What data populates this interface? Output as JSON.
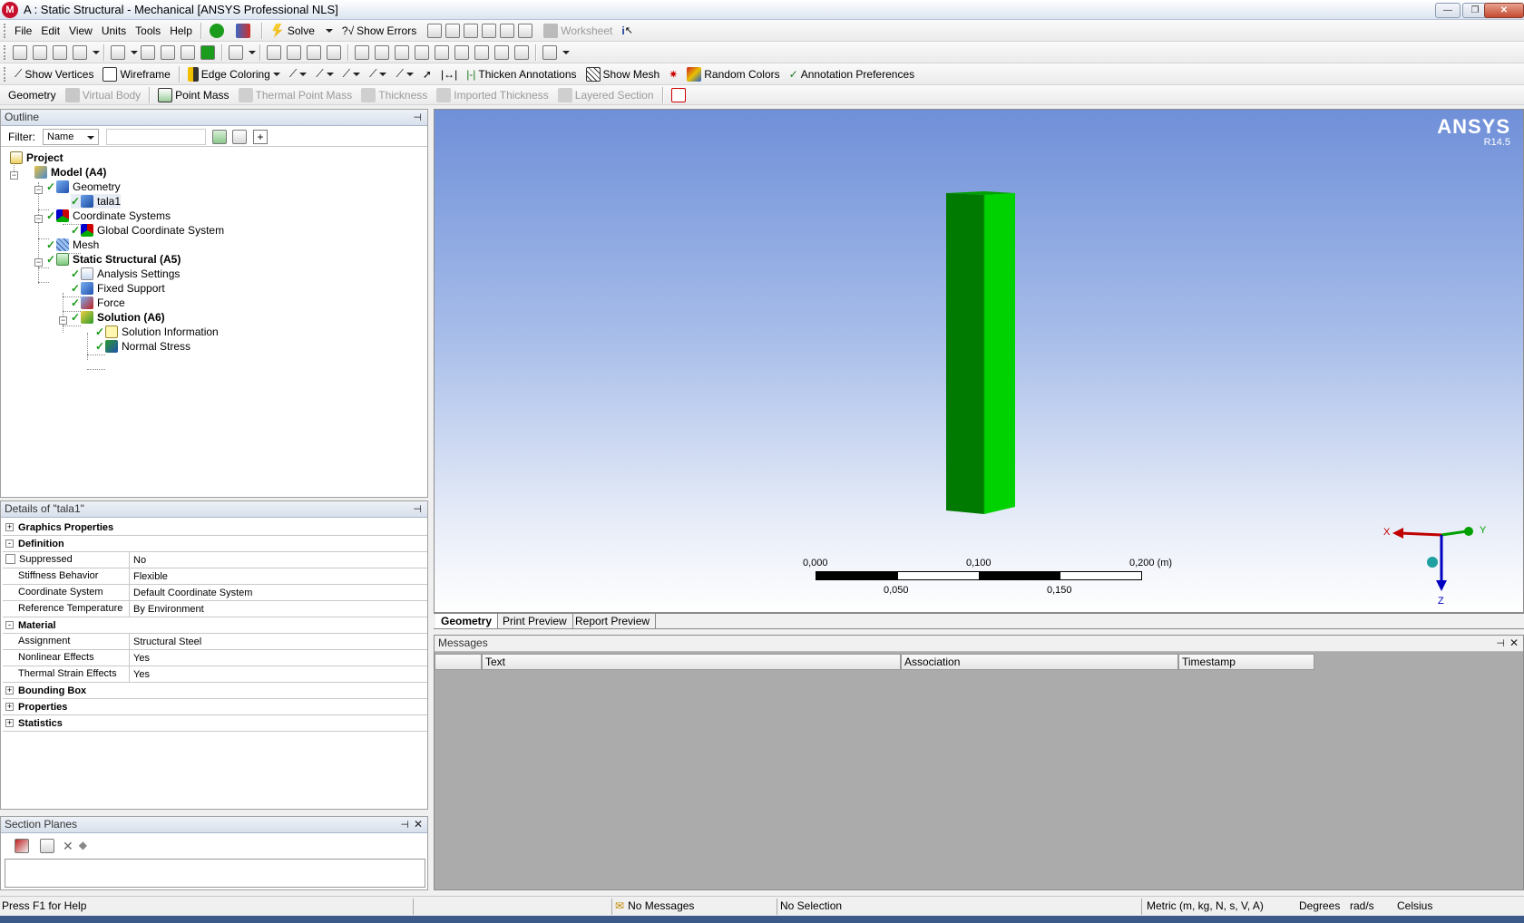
{
  "window": {
    "title": "A : Static Structural - Mechanical [ANSYS Professional NLS]",
    "app_icon": "M"
  },
  "menu": [
    "File",
    "Edit",
    "View",
    "Units",
    "Tools",
    "Help"
  ],
  "main_toolbar": {
    "solve": "Solve",
    "show_errors": "Show Errors",
    "worksheet": "Worksheet"
  },
  "graphics_toolbar": {
    "show_vertices": "Show Vertices",
    "wireframe": "Wireframe",
    "edge_coloring": "Edge Coloring",
    "thicken_annotations": "Thicken Annotations",
    "show_mesh": "Show Mesh",
    "random_colors": "Random Colors",
    "annotation_preferences": "Annotation Preferences"
  },
  "context_toolbar": {
    "geometry": "Geometry",
    "virtual_body": "Virtual Body",
    "point_mass": "Point Mass",
    "thermal_point_mass": "Thermal Point Mass",
    "thickness": "Thickness",
    "imported_thickness": "Imported Thickness",
    "layered_section": "Layered Section"
  },
  "outline": {
    "header": "Outline",
    "filter_label": "Filter:",
    "filter_value": "Name",
    "tree": [
      {
        "label": "Project",
        "bold": true
      },
      {
        "label": "Model (A4)",
        "bold": true
      },
      {
        "label": "Geometry",
        "bold": false
      },
      {
        "label": "tala1",
        "bold": false
      },
      {
        "label": "Coordinate Systems",
        "bold": false
      },
      {
        "label": "Global Coordinate System",
        "bold": false
      },
      {
        "label": "Mesh",
        "bold": false
      },
      {
        "label": "Static Structural (A5)",
        "bold": true
      },
      {
        "label": "Analysis Settings",
        "bold": false
      },
      {
        "label": "Fixed Support",
        "bold": false
      },
      {
        "label": "Force",
        "bold": false
      },
      {
        "label": "Solution (A6)",
        "bold": true
      },
      {
        "label": "Solution Information",
        "bold": false
      },
      {
        "label": "Normal Stress",
        "bold": false
      }
    ]
  },
  "details": {
    "header": "Details of \"tala1\"",
    "rows": [
      {
        "category": "Graphics Properties",
        "expander": "+"
      },
      {
        "category": "Definition",
        "expander": "-"
      },
      {
        "key": "Suppressed",
        "value": "No"
      },
      {
        "key": "Stiffness Behavior",
        "value": "Flexible"
      },
      {
        "key": "Coordinate System",
        "value": "Default Coordinate System"
      },
      {
        "key": "Reference Temperature",
        "value": "By Environment"
      },
      {
        "category": "Material",
        "expander": "-"
      },
      {
        "key": "Assignment",
        "value": "Structural Steel"
      },
      {
        "key": "Nonlinear Effects",
        "value": "Yes"
      },
      {
        "key": "Thermal Strain Effects",
        "value": "Yes"
      },
      {
        "category": "Bounding Box",
        "expander": "+"
      },
      {
        "category": "Properties",
        "expander": "+"
      },
      {
        "category": "Statistics",
        "expander": "+"
      }
    ]
  },
  "section_planes": {
    "header": "Section Planes"
  },
  "viewport": {
    "brand": "ANSYS",
    "version": "R14.5",
    "scale": {
      "top_labels": [
        "0,000",
        "0,100",
        "0,200 (m)"
      ],
      "bottom_labels": [
        "0,050",
        "0,150"
      ]
    },
    "triad": {
      "x": "X",
      "y": "Y",
      "z": "Z"
    },
    "colors": {
      "body_front": "#007a00",
      "body_side": "#00d100",
      "x_axis": "#c00000",
      "y_axis": "#00a000",
      "z_axis": "#0000c0"
    }
  },
  "view_tabs": [
    "Geometry",
    "Print Preview",
    "Report Preview"
  ],
  "messages": {
    "header": "Messages",
    "columns": [
      "Text",
      "Association",
      "Timestamp"
    ]
  },
  "status": {
    "help": "Press F1 for Help",
    "messages": "No Messages",
    "selection": "No Selection",
    "units": "Metric (m, kg, N, s, V, A)",
    "angle": "Degrees",
    "rate": "rad/s",
    "temperature": "Celsius"
  }
}
